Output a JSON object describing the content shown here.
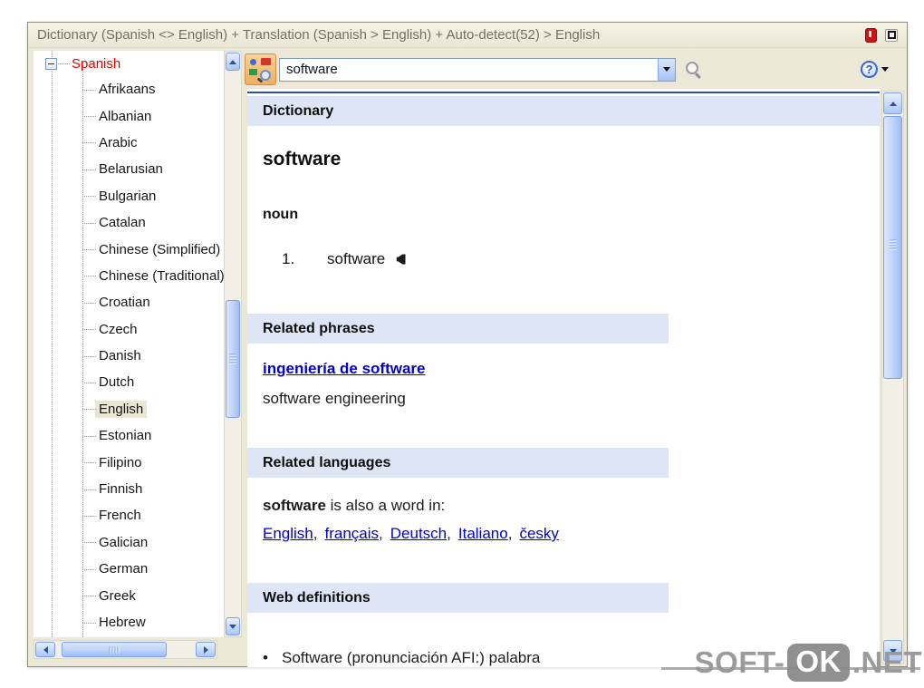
{
  "window": {
    "title": "Dictionary (Spanish <> English) + Translation (Spanish > English) + Auto-detect(52) > English"
  },
  "sidebar": {
    "root_label": "Spanish",
    "items": [
      "Afrikaans",
      "Albanian",
      "Arabic",
      "Belarusian",
      "Bulgarian",
      "Catalan",
      "Chinese (Simplified)",
      "Chinese (Traditional)",
      "Croatian",
      "Czech",
      "Danish",
      "Dutch",
      "English",
      "Estonian",
      "Filipino",
      "Finnish",
      "French",
      "Galician",
      "German",
      "Greek",
      "Hebrew"
    ],
    "selected_item": "English"
  },
  "searchbar": {
    "value": "software",
    "placeholder": ""
  },
  "content": {
    "dictionary_header": "Dictionary",
    "headword": "software",
    "part_of_speech": "noun",
    "definitions": [
      {
        "number": "1.",
        "text": "software"
      }
    ],
    "related_phrases": {
      "header": "Related phrases",
      "entries": [
        {
          "phrase": "ingeniería de software",
          "translation": "software engineering"
        }
      ]
    },
    "related_languages": {
      "header": "Related languages",
      "word": "software",
      "text": " is also a word in: ",
      "languages": [
        "English",
        "français",
        "Deutsch",
        "Italiano",
        "česky"
      ],
      "separator": ","
    },
    "web_definitions": {
      "header": "Web definitions",
      "bullet": "•",
      "partial_text": "Software (pronunciación AFI:) palabra"
    }
  },
  "watermark": {
    "left": "SOFT-",
    "badge": "OK",
    "right": ".NET"
  },
  "icons": {
    "titlebar": [
      "pin-icon",
      "restore-icon"
    ],
    "toolbar": [
      "dictionary-search-icon",
      "chevron-down-icon",
      "magnifier-icon",
      "help-icon"
    ],
    "definition": "speaker-icon"
  },
  "colors": {
    "link_blue": "#0000cc",
    "root_red": "#e60000",
    "section_band": "#dee5f4",
    "selection_bg": "#eae6d1",
    "title_text": "#70725f",
    "accent_line": "#2c50a8",
    "pin_red": "#d21212",
    "search_button_orange": "#eeae60"
  }
}
